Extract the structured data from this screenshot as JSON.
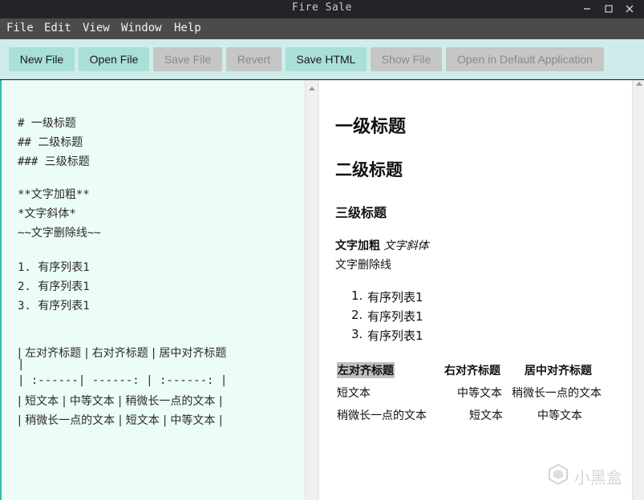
{
  "window": {
    "title": "Fire Sale"
  },
  "menu": [
    "File",
    "Edit",
    "View",
    "Window",
    "Help"
  ],
  "toolbar": {
    "buttons": [
      {
        "label": "New File",
        "enabled": true
      },
      {
        "label": "Open File",
        "enabled": true
      },
      {
        "label": "Save File",
        "enabled": false
      },
      {
        "label": "Revert",
        "enabled": false
      },
      {
        "label": "Save HTML",
        "enabled": true
      },
      {
        "label": "Show File",
        "enabled": false
      },
      {
        "label": "Open in Default Application",
        "enabled": false
      }
    ]
  },
  "editor": {
    "lines": [
      "# 一级标题",
      "## 二级标题",
      "### 三级标题",
      "**文字加粗**",
      "*文字斜体*",
      "~~文字删除线~~",
      "1. 有序列表1",
      "2. 有序列表1",
      "3. 有序列表1",
      "| 左对齐标题 | 右对齐标题 | 居中对齐标题",
      "|",
      "| :------| ------: | :------: |",
      "| 短文本 | 中等文本 | 稍微长一点的文本 |",
      "| 稍微长一点的文本 | 短文本 | 中等文本 |"
    ]
  },
  "preview": {
    "h1": "一级标题",
    "h2": "二级标题",
    "h3": "三级标题",
    "bold": "文字加粗",
    "italic": "文字斜体",
    "strike": "文字删除线",
    "list": [
      "有序列表1",
      "有序列表1",
      "有序列表1"
    ],
    "list_numbers": [
      "1.",
      "2.",
      "3."
    ],
    "table": {
      "headers": [
        "左对齐标题",
        "右对齐标题",
        "居中对齐标题"
      ],
      "rows": [
        [
          "短文本",
          "中等文本",
          "稍微长一点的文本"
        ],
        [
          "稍微长一点的文本",
          "短文本",
          "中等文本"
        ]
      ]
    }
  },
  "watermark": {
    "text": "小黑盒"
  },
  "colors": {
    "toolbar_bg": "#cfecea",
    "button_enabled": "#a9dfd7",
    "button_disabled": "#c6c6c6",
    "editor_bg": "#ecfcf8",
    "menubar_bg": "#4b4b4b"
  }
}
